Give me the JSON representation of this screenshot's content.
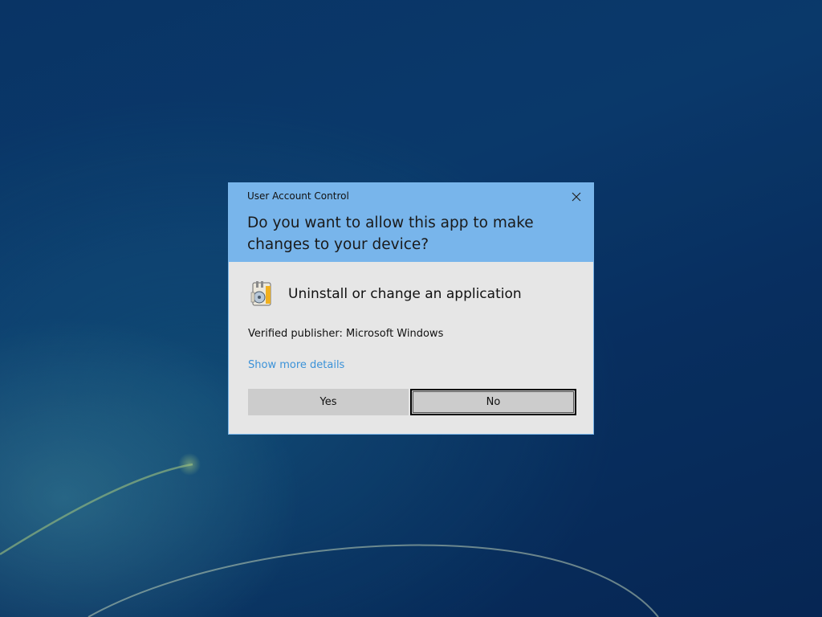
{
  "dialog": {
    "window_title": "User Account Control",
    "headline": "Do you want to allow this app to make changes to your device?",
    "app_name": "Uninstall or change an application",
    "publisher": "Verified publisher: Microsoft Windows",
    "details_link": "Show more details",
    "yes_label": "Yes",
    "no_label": "No",
    "close_icon": "close-icon",
    "app_icon": "control-panel-programs-icon"
  },
  "colors": {
    "header_bg": "#78b5eb",
    "body_bg": "#e6e6e6",
    "link": "#3b92d8",
    "button_bg": "#cccccc"
  }
}
